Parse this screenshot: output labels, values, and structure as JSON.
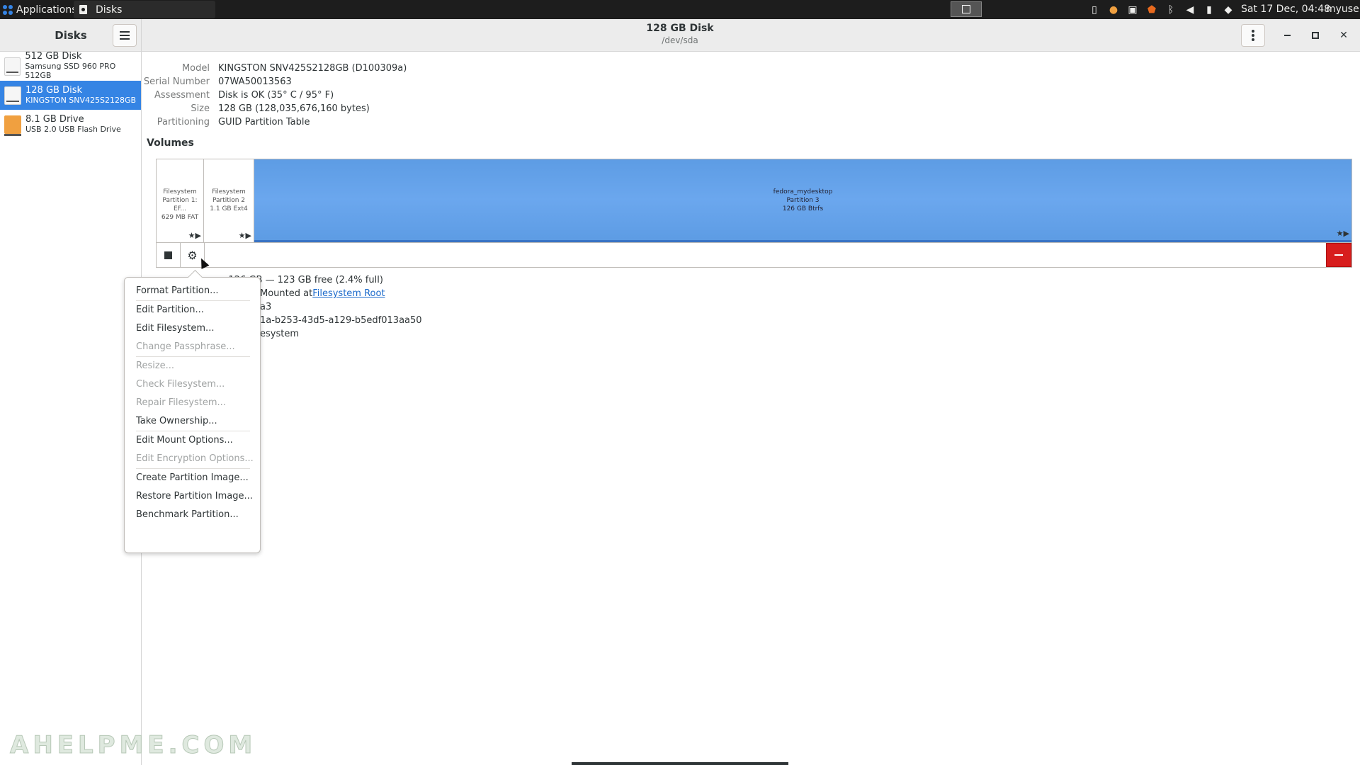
{
  "top_panel": {
    "applications_label": "Applications",
    "task_label": "Disks",
    "clock": "Sat 17 Dec, 04:48",
    "user": "myuser",
    "tray_icons": [
      "clipboard-icon",
      "update-icon",
      "network-icon",
      "shield-icon",
      "bluetooth-icon",
      "volume-icon",
      "battery-icon",
      "notification-icon"
    ]
  },
  "header": {
    "left_title": "Disks",
    "title": "128 GB Disk",
    "subtitle": "/dev/sda"
  },
  "sidebar": {
    "items": [
      {
        "name": "512 GB Disk",
        "sub": "Samsung SSD 960 PRO 512GB",
        "icon": "hdd-icon"
      },
      {
        "name": "128 GB Disk",
        "sub": "KINGSTON SNV425S2128GB",
        "icon": "hdd-icon",
        "selected": true
      },
      {
        "name": "8.1 GB Drive",
        "sub": "USB 2.0 USB Flash Drive",
        "icon": "usb-drive-icon"
      }
    ]
  },
  "disk": {
    "model_label": "Model",
    "model": "KINGSTON SNV425S2128GB (D100309a)",
    "serial_label": "Serial Number",
    "serial": "07WA50013563",
    "assessment_label": "Assessment",
    "assessment": "Disk is OK (35° C / 95° F)",
    "size_label": "Size",
    "size": "128 GB (128,035,676,160 bytes)",
    "partitioning_label": "Partitioning",
    "partitioning": "GUID Partition Table"
  },
  "volumes": {
    "label": "Volumes",
    "partitions": [
      {
        "l1": "Filesystem",
        "l2": "Partition 1: EF...",
        "l3": "629 MB FAT"
      },
      {
        "l1": "Filesystem",
        "l2": "Partition 2",
        "l3": "1.1 GB Ext4"
      },
      {
        "l1": "fedora_mydesktop",
        "l2": "Partition 3",
        "l3": "126 GB Btrfs"
      }
    ],
    "partition_icons": "★▶"
  },
  "details": {
    "size_tail": "... 126 GB — 123 GB free (2.4% full)",
    "contents_prefix": "Mounted at ",
    "contents_link": "Filesystem Root",
    "device_tail": "a3",
    "uuid_tail": "1a-b253-43d5-a129-b5edf013aa50",
    "type_tail": "esystem"
  },
  "menu": {
    "groups": [
      [
        {
          "label": "Format Partition...",
          "enabled": true
        }
      ],
      [
        {
          "label": "Edit Partition...",
          "enabled": true
        },
        {
          "label": "Edit Filesystem...",
          "enabled": true
        },
        {
          "label": "Change Passphrase...",
          "enabled": false
        }
      ],
      [
        {
          "label": "Resize...",
          "enabled": false
        },
        {
          "label": "Check Filesystem...",
          "enabled": false
        },
        {
          "label": "Repair Filesystem...",
          "enabled": false
        },
        {
          "label": "Take Ownership...",
          "enabled": true
        }
      ],
      [
        {
          "label": "Edit Mount Options...",
          "enabled": true
        },
        {
          "label": "Edit Encryption Options...",
          "enabled": false
        }
      ],
      [
        {
          "label": "Create Partition Image...",
          "enabled": true
        },
        {
          "label": "Restore Partition Image...",
          "enabled": true
        },
        {
          "label": "Benchmark Partition...",
          "enabled": true
        }
      ]
    ]
  },
  "watermark": "AHELPME.COM",
  "colors": {
    "accent": "#3584e4",
    "partition_fill": "#6ba7ee",
    "danger": "#d71d1d"
  }
}
